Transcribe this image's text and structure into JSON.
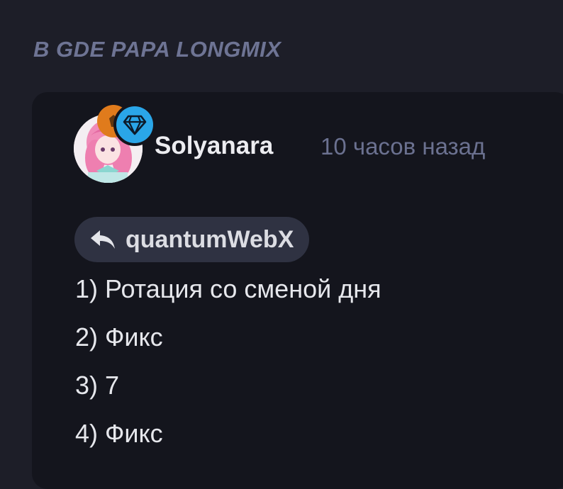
{
  "section": {
    "title": "В GDE PAPA LONGMIX"
  },
  "comment": {
    "author": "Solyanara",
    "time": "10 часов назад",
    "avatar_icon": "anime-avatar",
    "badges": [
      "rank-badge-icon",
      "diamond-icon"
    ],
    "reply_to": "quantumWebX",
    "lines": [
      "1) Ротация со сменой дня",
      "2) Фикс",
      "3) 7",
      "4) Фикс"
    ]
  },
  "colors": {
    "background": "#1d1e28",
    "card": "#14151d",
    "accent_diamond": "#2aa6e8",
    "rank_orange": "#e07b1c",
    "muted_text": "#6b7190"
  }
}
